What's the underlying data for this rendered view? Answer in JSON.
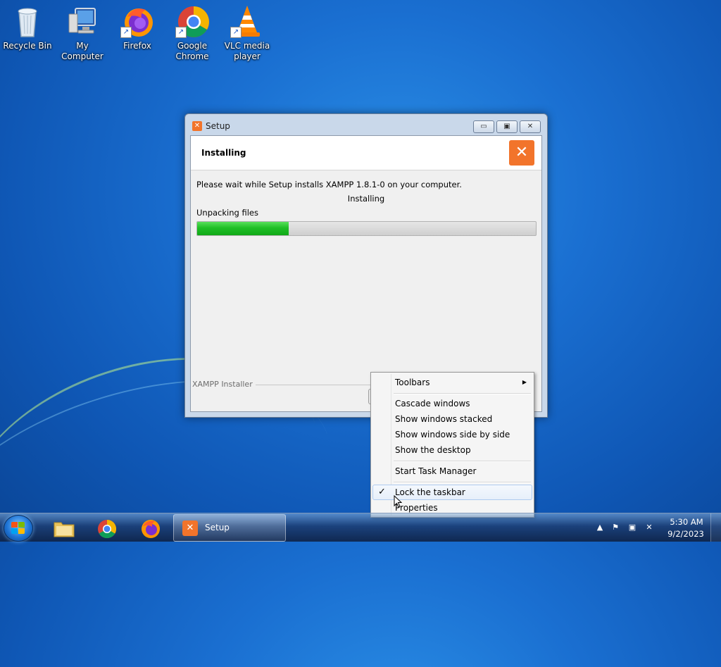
{
  "desktop": {
    "icons": [
      {
        "label": "Recycle Bin"
      },
      {
        "label": "My Computer"
      },
      {
        "label": "Firefox"
      },
      {
        "label": "Google Chrome"
      },
      {
        "label": "VLC media player"
      }
    ]
  },
  "window": {
    "title": "Setup",
    "header_title": "Installing",
    "wait_text": "Please wait while Setup installs XAMPP 1.8.1-0 on your computer.",
    "status_text": "Installing",
    "unpack_text": "Unpacking files",
    "progress_percent": 27,
    "branding": "XAMPP Installer",
    "buttons": {
      "minimize": "▭",
      "maximize": "▣",
      "close": "✕"
    }
  },
  "context_menu": {
    "items": [
      {
        "label": "Toolbars",
        "submenu": true
      },
      {
        "label": "Cascade windows"
      },
      {
        "label": "Show windows stacked"
      },
      {
        "label": "Show windows side by side"
      },
      {
        "label": "Show the desktop"
      },
      {
        "label": "Start Task Manager"
      },
      {
        "label": "Lock the taskbar",
        "checked": true
      },
      {
        "label": "Properties"
      }
    ]
  },
  "taskbar": {
    "task_label": "Setup",
    "clock_time": "5:30 AM",
    "clock_date": "9/2/2023"
  },
  "icons": {
    "checkmark": "✓",
    "submenu_arrow": "▶"
  }
}
